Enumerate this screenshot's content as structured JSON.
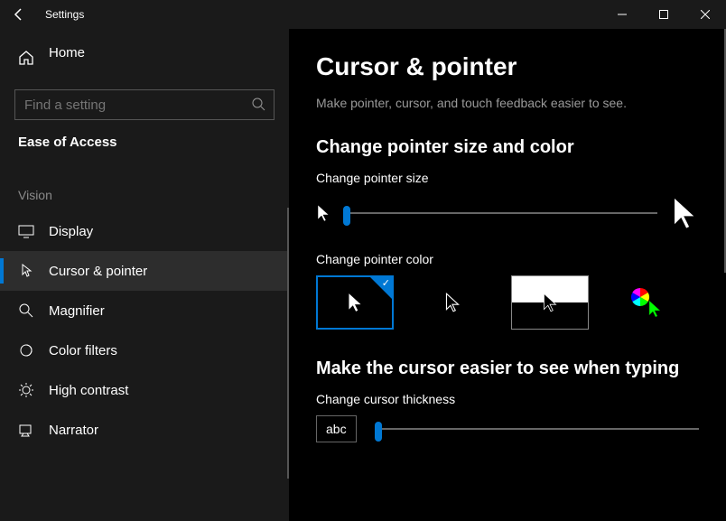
{
  "titlebar": {
    "app": "Settings"
  },
  "sidebar": {
    "home": "Home",
    "search_placeholder": "Find a setting",
    "category": "Ease of Access",
    "group": "Vision",
    "items": [
      {
        "label": "Display"
      },
      {
        "label": "Cursor & pointer"
      },
      {
        "label": "Magnifier"
      },
      {
        "label": "Color filters"
      },
      {
        "label": "High contrast"
      },
      {
        "label": "Narrator"
      }
    ]
  },
  "page": {
    "title": "Cursor & pointer",
    "description": "Make pointer, cursor, and touch feedback easier to see.",
    "section1_title": "Change pointer size and color",
    "size_label": "Change pointer size",
    "color_label": "Change pointer color",
    "section2_title": "Make the cursor easier to see when typing",
    "thickness_label": "Change cursor thickness",
    "abc_sample": "abc"
  }
}
